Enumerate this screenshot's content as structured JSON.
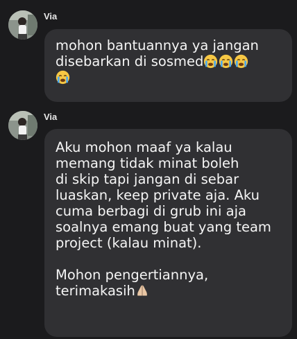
{
  "messages": [
    {
      "sender": "Via",
      "text": "mohon bantuannya ya jangan\ndisebarkan di sosmed",
      "trailing_emojis": [
        "loudly-crying-face-emoji",
        "loudly-crying-face-emoji",
        "loudly-crying-face-emoji",
        "loudly-crying-face-emoji"
      ]
    },
    {
      "sender": "Via",
      "text": "Aku mohon maaf ya kalau\nmemang tidak minat boleh\ndi skip tapi jangan di sebar\nluaskan, keep private aja. Aku\ncuma berbagi di grub ini aja\nsoalnya emang buat yang team\nproject (kalau minat).\n\nMohon pengertiannya,\nterimakasih",
      "trailing_emojis": [
        "folded-hands-emoji"
      ]
    }
  ],
  "colors": {
    "background": "#1b1b1d",
    "bubble": "#303033",
    "text": "#f5f5f5"
  }
}
